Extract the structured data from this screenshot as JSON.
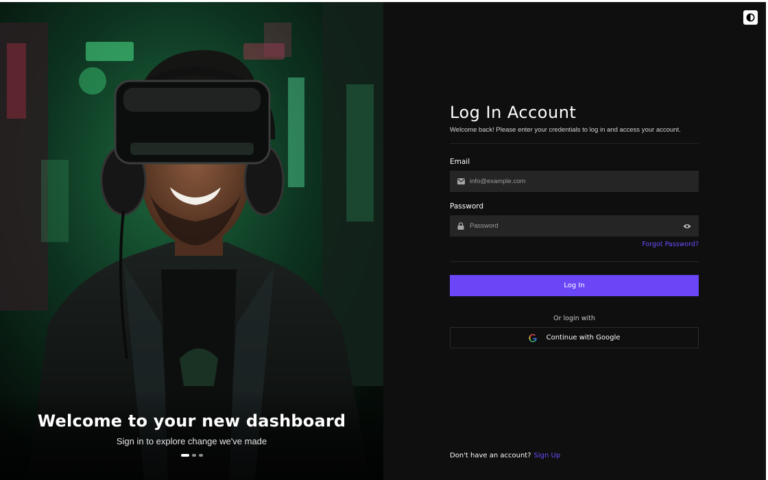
{
  "hero": {
    "title": "Welcome to your new dashboard",
    "subtitle": "Sign in to explore change we've made",
    "carousel": {
      "slides": 3,
      "active_index": 0
    }
  },
  "theme_toggle": {
    "icon": "contrast-icon"
  },
  "form": {
    "heading": "Log In Account",
    "welcome_text": "Welcome back! Please enter your credentials to log in and access your account.",
    "email": {
      "label": "Email",
      "placeholder": "info@example.com",
      "value": "",
      "icon": "mail-icon"
    },
    "password": {
      "label": "Password",
      "placeholder": "Password",
      "value": "",
      "icon": "lock-icon",
      "toggle_icon": "eye-icon"
    },
    "forgot_password": "Forgot Password?",
    "login_button": "Log In",
    "or_text": "Or login with",
    "google_button": "Continue with Google",
    "google_icon": "google-icon"
  },
  "footer": {
    "prompt": "Don't have an account?",
    "signup_link": "Sign Up"
  },
  "colors": {
    "accent": "#6a46f6",
    "link": "#6d4aff",
    "panel_bg": "#0f0f0f",
    "input_bg": "#252525"
  }
}
